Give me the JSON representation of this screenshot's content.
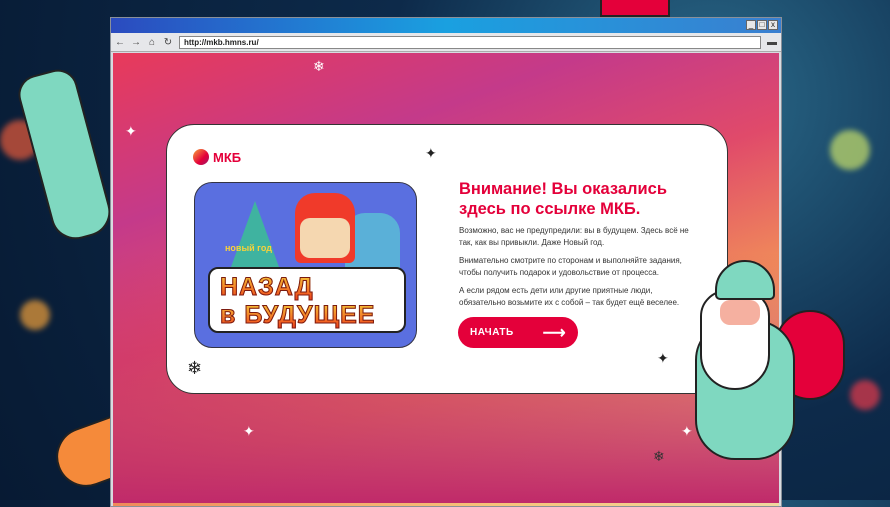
{
  "browser": {
    "url": "http://mkb.hmns.ru/",
    "window_buttons": [
      "_",
      "□",
      "x"
    ]
  },
  "logo": {
    "text": "МКБ"
  },
  "banner": {
    "line1": "НАЗАД",
    "line2": "в БУДУЩЕЕ",
    "tree_text": "новый год"
  },
  "main": {
    "heading": "Внимание! Вы оказались здесь по ссылке МКБ.",
    "paragraphs": [
      "Возможно, вас не предупредили: вы в будущем. Здесь всё не так, как вы привыкли. Даже Новый год.",
      "Внимательно смотрите по сторонам и выполняйте задания, чтобы получить подарок и удовольствие от процесса.",
      "А если рядом есть дети или другие приятные люди, обязательно возьмите их с собой – так будет ещё веселее."
    ],
    "start_button": "НАЧАТЬ"
  },
  "colors": {
    "brand": "#e4003a"
  }
}
